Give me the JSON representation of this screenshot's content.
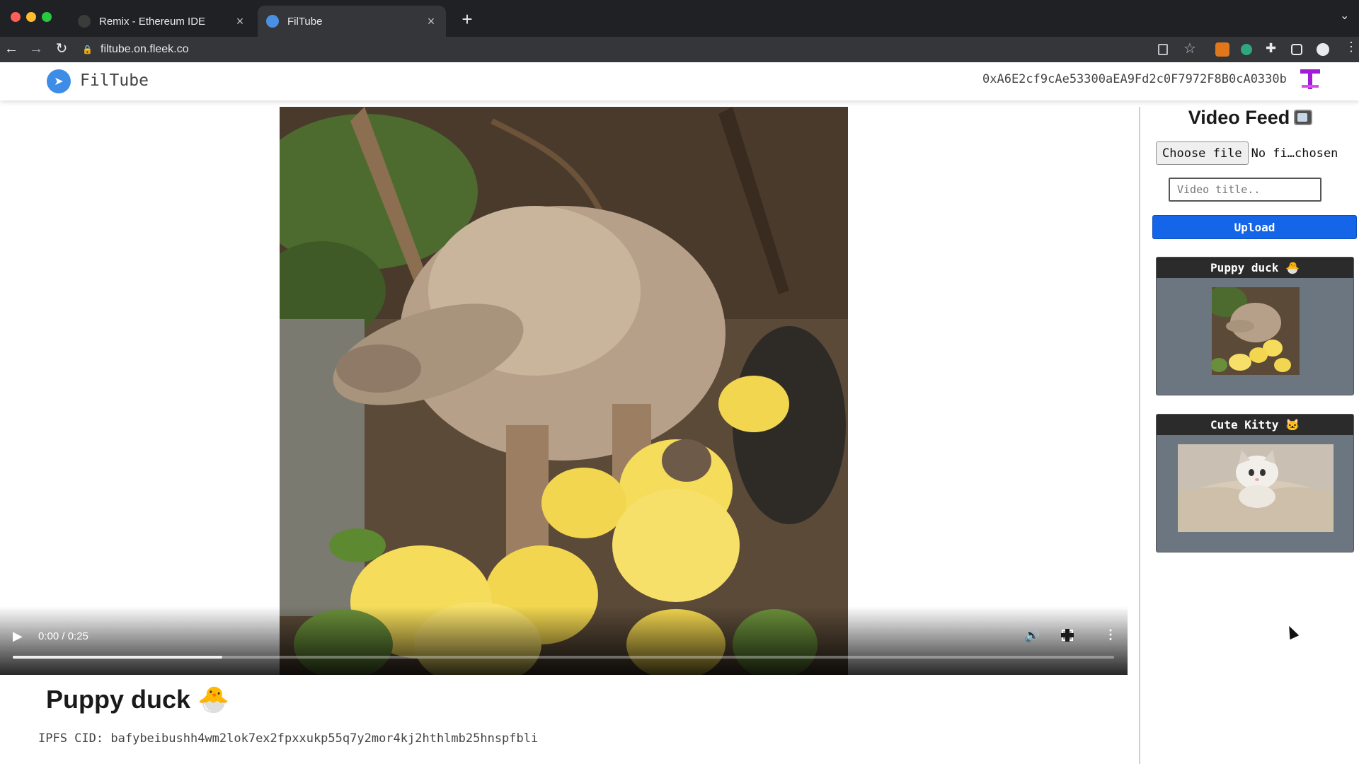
{
  "browser": {
    "tabs": [
      {
        "title": "Remix - Ethereum IDE",
        "active": false
      },
      {
        "title": "FilTube",
        "active": true
      }
    ],
    "url": "filtube.on.fleek.co"
  },
  "header": {
    "brand": "FilTube",
    "wallet_address": "0xA6E2cf9cAe53300aEA9Fd2c0F7972F8B0cA0330b"
  },
  "player": {
    "time": "0:00 / 0:25",
    "buffered_fraction": 0.19,
    "current": {
      "title": "Puppy duck 🐣",
      "cid_label": "IPFS CID:",
      "cid": "bafybeibushh4wm2lok7ex2fpxxukp55q7y2mor4kj2hthlmb25hnspfbli"
    }
  },
  "sidebar": {
    "title": "Video Feed",
    "file_button": "Choose file",
    "file_status": "No fi…chosen",
    "title_placeholder": "Video title..",
    "upload_label": "Upload",
    "videos": [
      {
        "title": "Puppy duck 🐣"
      },
      {
        "title": "Cute Kitty 🐱"
      }
    ]
  },
  "colors": {
    "accent": "#1465e8",
    "card_bg": "#6c7680",
    "card_header": "#2b2b2b",
    "logo": "#3d8ce6",
    "avatar": "#a21bd6"
  }
}
